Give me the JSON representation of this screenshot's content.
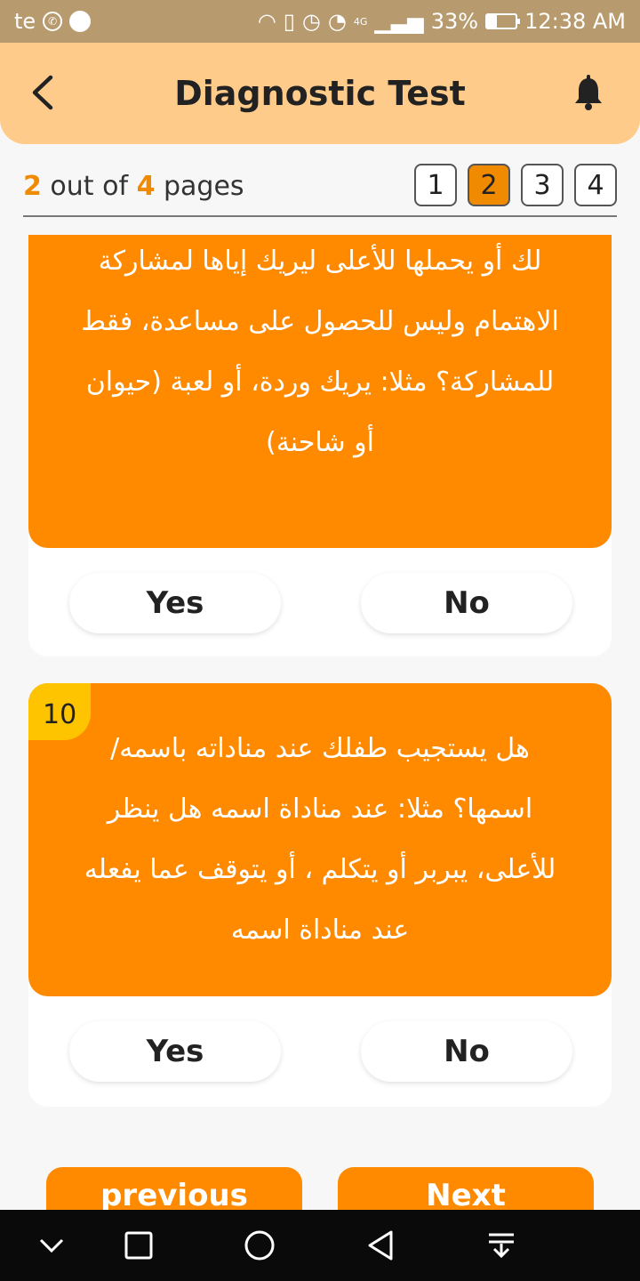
{
  "status_bar": {
    "left_text": "te",
    "network": "4G",
    "battery": "33%",
    "battery_level": 0.33,
    "time": "12:38 AM"
  },
  "header": {
    "title": "Diagnostic Test",
    "back_icon": "chevron-left-icon",
    "bell_icon": "bell-icon"
  },
  "pagination": {
    "current": "2",
    "out_of": "out of",
    "total": "4",
    "pages_word": "pages",
    "pages": [
      "1",
      "2",
      "3",
      "4"
    ],
    "active_page": "2"
  },
  "questions": [
    {
      "text": "هل يستعرض طفلك الأشياء أمامك أو يقدمها لك أو يحملها للأعلى ليريك إياها لمشاركة الاهتمام وليس للحصول على مساعدة، فقط للمشاركة؟ مثلا: يريك وردة، أو لعبة (حيوان أو شاحنة)",
      "yes_label": "Yes",
      "no_label": "No"
    },
    {
      "number": "10",
      "text": "هل يستجيب طفلك عند مناداته باسمه/ اسمها؟ مثلا: عند مناداة اسمه هل ينظر للأعلى، يبربر أو يتكلم ، أو يتوقف عما يفعله عند مناداة اسمه",
      "yes_label": "Yes",
      "no_label": "No"
    }
  ],
  "navigation": {
    "previous_label": "previous",
    "next_label": "Next"
  },
  "colors": {
    "accent": "#ff8a00",
    "header_bg": "#ffcb8a",
    "number_badge": "#ffc400",
    "status_bar": "#b79a6e"
  }
}
